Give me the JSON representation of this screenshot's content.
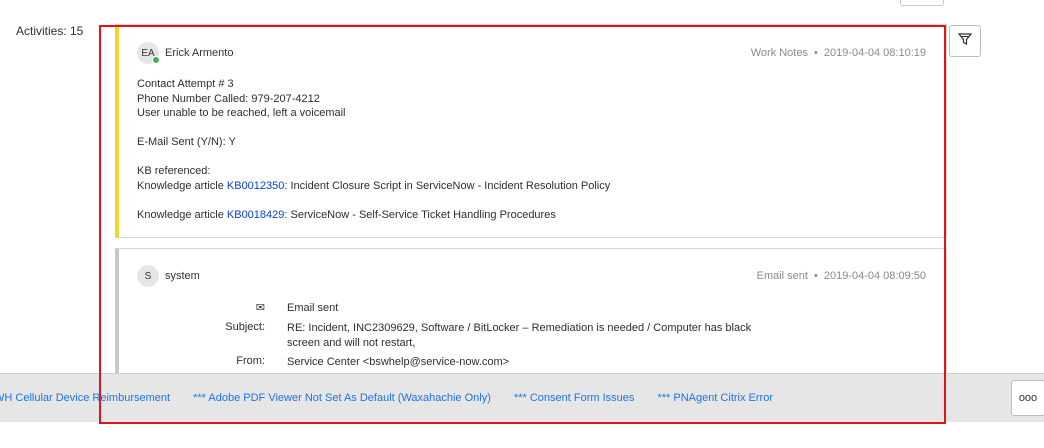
{
  "activities_label": "Activities: 15",
  "filter_icon": "funnel-icon",
  "entries": [
    {
      "initials": "EA",
      "author": "Erick Armento",
      "type": "Work Notes",
      "timestamp": "2019-04-04 08:10:19",
      "lines": {
        "l1": "Contact Attempt # 3",
        "l2": "Phone Number Called: 979-207-4212",
        "l3": "User unable to be reached, left a voicemail",
        "l4": "E-Mail Sent (Y/N): Y",
        "l5": "KB referenced:",
        "kb1_prefix": "Knowledge article ",
        "kb1_link": "KB0012350",
        "kb1_suffix": ": Incident Closure Script in ServiceNow - Incident Resolution Policy",
        "kb2_prefix": "Knowledge article ",
        "kb2_link": "KB0018429",
        "kb2_suffix": ": ServiceNow - Self-Service Ticket Handling Procedures"
      }
    },
    {
      "initials": "S",
      "author": "system",
      "type": "Email sent",
      "timestamp": "2019-04-04 08:09:50",
      "email_status": "Email sent",
      "subject_label": "Subject:",
      "subject_value": "RE: Incident, INC2309629, Software / BitLocker – Remediation is needed / Computer has black screen and will not restart,",
      "from_label": "From:",
      "from_value": "Service Center <bswhelp@service-now.com>"
    }
  ],
  "bottom_links": [
    "WH Cellular Device Reimbursement",
    "*** Adobe PDF Viewer Not Set As Default (Waxahachie Only)",
    "*** Consent Form Issues",
    "*** PNAgent Citrix Error"
  ],
  "more_label": "ooo"
}
